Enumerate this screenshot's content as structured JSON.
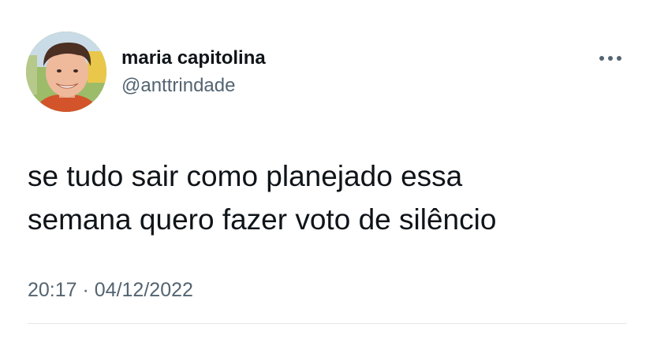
{
  "tweet": {
    "author": {
      "display_name": "maria capitolina",
      "handle": "@anttrindade"
    },
    "text": "se tudo sair como planejado essa\nsemana quero fazer voto de silêncio",
    "timestamp": "20:17 · 04/12/2022",
    "icons": {
      "more": "more-horizontal-icon"
    }
  },
  "colors": {
    "text_primary": "#0f1419",
    "text_secondary": "#536471",
    "divider": "#e3e7ea",
    "background": "#ffffff"
  }
}
